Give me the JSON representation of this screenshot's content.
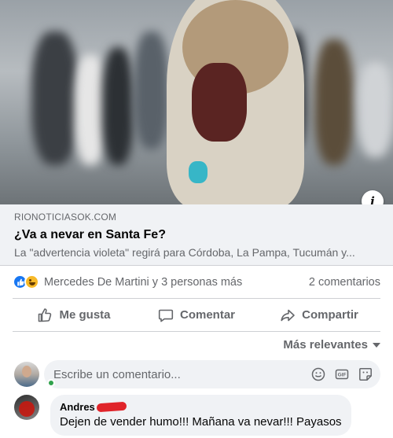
{
  "link_preview": {
    "domain": "RIONOTICIASOK.COM",
    "title": "¿Va a nevar en Santa Fe?",
    "description": "La \"advertencia violeta\" regirá para Córdoba, La Pampa, Tucumán y...",
    "info_icon": "info-icon"
  },
  "stats": {
    "reactions": [
      "like-icon",
      "haha-icon"
    ],
    "reactors_text": "Mercedes De Martini y 3 personas más",
    "comments_text": "2 comentarios"
  },
  "actions": {
    "like_label": "Me gusta",
    "comment_label": "Comentar",
    "share_label": "Compartir"
  },
  "sort": {
    "label": "Más relevantes"
  },
  "composer": {
    "placeholder": "Escribe un comentario...",
    "icons": [
      "emoji-icon",
      "gif-icon",
      "sticker-icon"
    ]
  },
  "comments": [
    {
      "author": "Andres",
      "text": "Dejen de vender humo!!! Mañana va nevar!!! Payasos"
    }
  ],
  "colors": {
    "accent": "#1877f2",
    "muted": "#65676b",
    "bubble": "#f0f2f5",
    "online": "#31a24c"
  }
}
